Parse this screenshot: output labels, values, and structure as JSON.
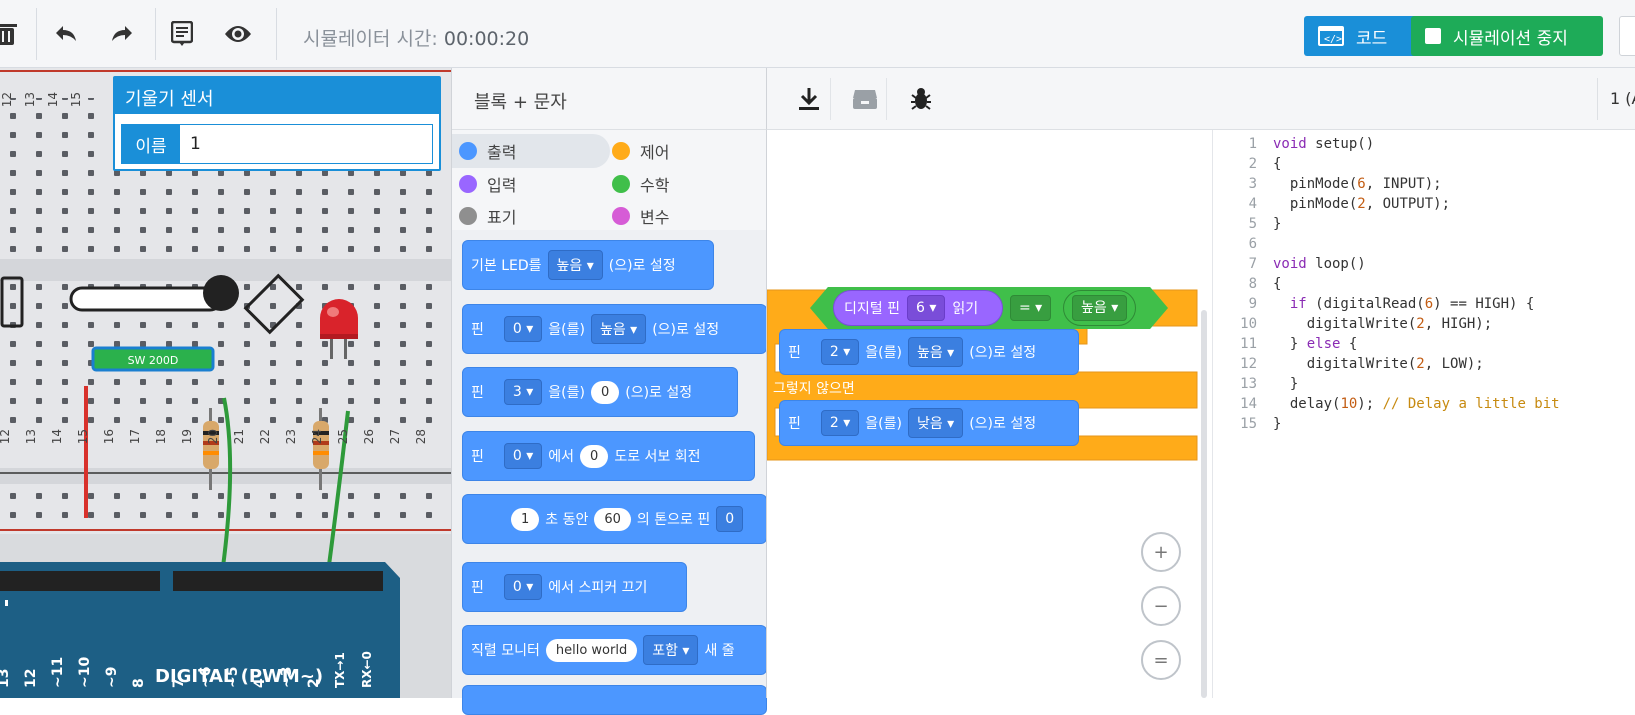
{
  "toolbar": {
    "sim_time_label": "시뮬레이터 시간:",
    "sim_time_value": "00:00:20",
    "code_button": "코드",
    "stop_sim_button": "시뮬레이션 중지"
  },
  "inspector": {
    "title": "기울기 센서",
    "name_label": "이름",
    "name_value": "1"
  },
  "circuit": {
    "top_row_numbers": [
      "12",
      "13",
      "14",
      "15"
    ],
    "mid_row_numbers": [
      "12",
      "13",
      "14",
      "15",
      "16",
      "17",
      "18",
      "19",
      "20",
      "21",
      "22",
      "23",
      "24",
      "25",
      "26",
      "27",
      "28"
    ],
    "switch_label": "SW 200D",
    "arduino_pins": [
      "13",
      "12",
      "~11",
      "~10",
      "~9",
      "8",
      "7",
      "~6",
      "~5",
      "4",
      "~3",
      "2",
      "TX→1",
      "RX←0"
    ],
    "arduino_label": "DIGITAL (PWM~)"
  },
  "palette": {
    "header": "블록 + 문자",
    "categories": [
      {
        "label": "출력",
        "color": "#4c97ff"
      },
      {
        "label": "제어",
        "color": "#ffab19"
      },
      {
        "label": "입력",
        "color": "#9966ff"
      },
      {
        "label": "수학",
        "color": "#40bf4a"
      },
      {
        "label": "표기",
        "color": "#8f8f8f"
      },
      {
        "label": "변수",
        "color": "#d65cd6"
      }
    ],
    "blocks": {
      "b1": {
        "t1": "기본 LED를",
        "d1": "높음 ▾",
        "t2": "(으)로 설정"
      },
      "b2": {
        "t1": "핀",
        "d1": "0 ▾",
        "t2": "을(를)",
        "d2": "높음 ▾",
        "t3": "(으)로 설정"
      },
      "b3": {
        "t1": "핀",
        "d1": "3 ▾",
        "t2": "을(를)",
        "p1": "0",
        "t3": "(으)로 설정"
      },
      "b4": {
        "t1": "핀",
        "d1": "0 ▾",
        "t2": "에서",
        "p1": "0",
        "t3": "도로 서보 회전"
      },
      "b5": {
        "p1": "1",
        "t1": "초 동안",
        "p2": "60",
        "t2": "의 톤으로 핀",
        "d1": "0"
      },
      "b6": {
        "t1": "핀",
        "d1": "0 ▾",
        "t2": "에서 스피커 끄기"
      },
      "b7": {
        "t1": "직렬 모니터",
        "p1": "hello world",
        "d1": "포함 ▾",
        "t2": "새 줄"
      }
    }
  },
  "canvas": {
    "if_cond": {
      "read_label": "디지털 핀",
      "pin": "6 ▾",
      "read_suffix": "읽기",
      "op": "= ▾",
      "value": "높음 ▾"
    },
    "then_block": {
      "t1": "핀",
      "pin": "2 ▾",
      "t2": "을(를)",
      "val": "높음 ▾",
      "t3": "(으)로 설정"
    },
    "else_label": "그렇지 않으면",
    "else_block": {
      "t1": "핀",
      "pin": "2 ▾",
      "t2": "을(를)",
      "val": "낮음 ▾",
      "t3": "(으)로 설정"
    }
  },
  "code": {
    "top_right": "1 (A",
    "lines": [
      {
        "n": "1",
        "t": "void setup()"
      },
      {
        "n": "2",
        "t": "{"
      },
      {
        "n": "3",
        "t": "  pinMode(6, INPUT);"
      },
      {
        "n": "4",
        "t": "  pinMode(2, OUTPUT);"
      },
      {
        "n": "5",
        "t": "}"
      },
      {
        "n": "6",
        "t": ""
      },
      {
        "n": "7",
        "t": "void loop()"
      },
      {
        "n": "8",
        "t": "{"
      },
      {
        "n": "9",
        "t": "  if (digitalRead(6) == HIGH) {"
      },
      {
        "n": "10",
        "t": "    digitalWrite(2, HIGH);"
      },
      {
        "n": "11",
        "t": "  } else {"
      },
      {
        "n": "12",
        "t": "    digitalWrite(2, LOW);"
      },
      {
        "n": "13",
        "t": "  }"
      },
      {
        "n": "14",
        "t": "  delay(10); // Delay a little bit"
      },
      {
        "n": "15",
        "t": "}"
      }
    ]
  },
  "colors": {
    "output_blue": "#4c97ff",
    "control_orange": "#ffab19",
    "input_purple": "#9966ff",
    "math_green": "#40bf4a",
    "code_button": "#1a8fd8",
    "stop_button": "#1eab58"
  }
}
